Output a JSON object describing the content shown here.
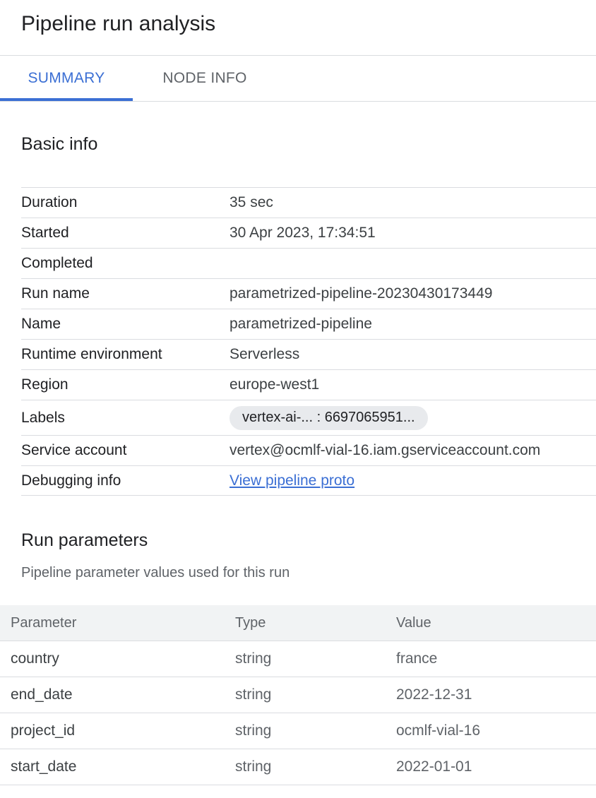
{
  "header": {
    "title": "Pipeline run analysis"
  },
  "tabs": [
    {
      "label": "SUMMARY",
      "active": true
    },
    {
      "label": "NODE INFO",
      "active": false
    }
  ],
  "basic_info": {
    "heading": "Basic info",
    "rows": [
      {
        "label": "Duration",
        "value": "35 sec"
      },
      {
        "label": "Started",
        "value": "30 Apr 2023, 17:34:51"
      },
      {
        "label": "Completed",
        "value": ""
      },
      {
        "label": "Run name",
        "value": "parametrized-pipeline-20230430173449"
      },
      {
        "label": "Name",
        "value": "parametrized-pipeline"
      },
      {
        "label": "Runtime environment",
        "value": "Serverless"
      },
      {
        "label": "Region",
        "value": "europe-west1"
      },
      {
        "label": "Labels",
        "value": "vertex-ai-... : 6697065951..."
      },
      {
        "label": "Service account",
        "value": "vertex@ocmlf-vial-16.iam.gserviceaccount.com"
      },
      {
        "label": "Debugging info",
        "value": "View pipeline proto"
      }
    ]
  },
  "run_parameters": {
    "heading": "Run parameters",
    "subtitle": "Pipeline parameter values used for this run",
    "columns": [
      "Parameter",
      "Type",
      "Value"
    ],
    "rows": [
      {
        "parameter": "country",
        "type": "string",
        "value": "france"
      },
      {
        "parameter": "end_date",
        "type": "string",
        "value": "2022-12-31"
      },
      {
        "parameter": "project_id",
        "type": "string",
        "value": "ocmlf-vial-16"
      },
      {
        "parameter": "start_date",
        "type": "string",
        "value": "2022-01-01"
      }
    ]
  },
  "colors": {
    "accent": "#3b6fd4",
    "divider": "#dadce0",
    "chip_bg": "#e8eaed",
    "header_bg": "#f1f3f4"
  }
}
